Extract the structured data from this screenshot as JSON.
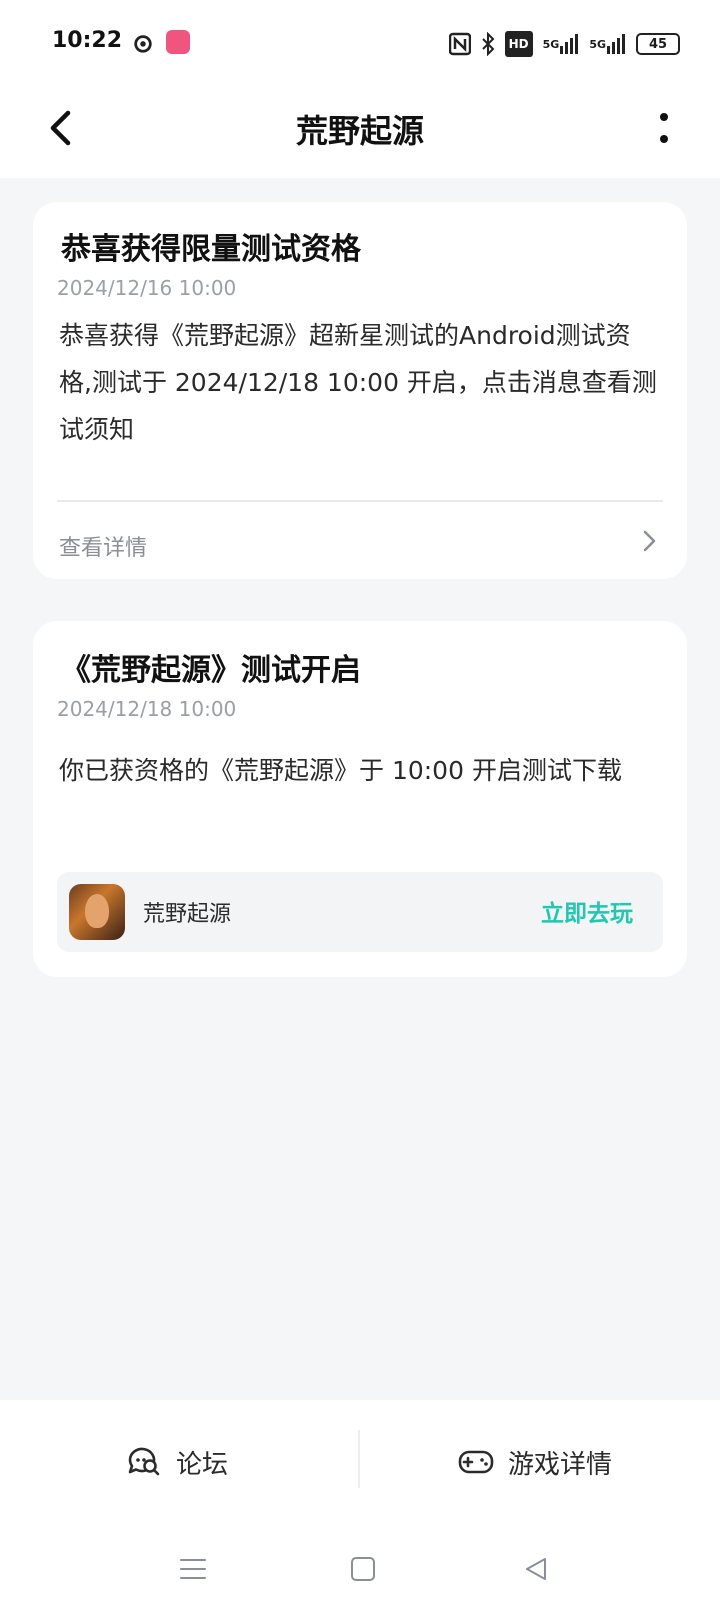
{
  "status_bar": {
    "time": "10:22",
    "network_label_1": "5G",
    "network_label_2": "5G",
    "hd_label": "HD",
    "battery": "45"
  },
  "header": {
    "title": "荒野起源"
  },
  "cards": [
    {
      "title": "恭喜获得限量测试资格",
      "time": "2024/12/16 10:00",
      "body": "恭喜获得《荒野起源》超新星测试的Android测试资格,测试于 2024/12/18 10:00 开启，点击消息查看测试须知",
      "detail_link": "查看详情"
    },
    {
      "title": "《荒野起源》测试开启",
      "time": "2024/12/18 10:00",
      "body": "你已获资格的《荒野起源》于 10:00 开启测试下载",
      "game_name": "荒野起源",
      "play_button": "立即去玩"
    }
  ],
  "bottom_bar": {
    "forum_label": "论坛",
    "game_detail_label": "游戏详情"
  },
  "colors": {
    "accent": "#21c7b1",
    "background": "#f5f6f8"
  }
}
